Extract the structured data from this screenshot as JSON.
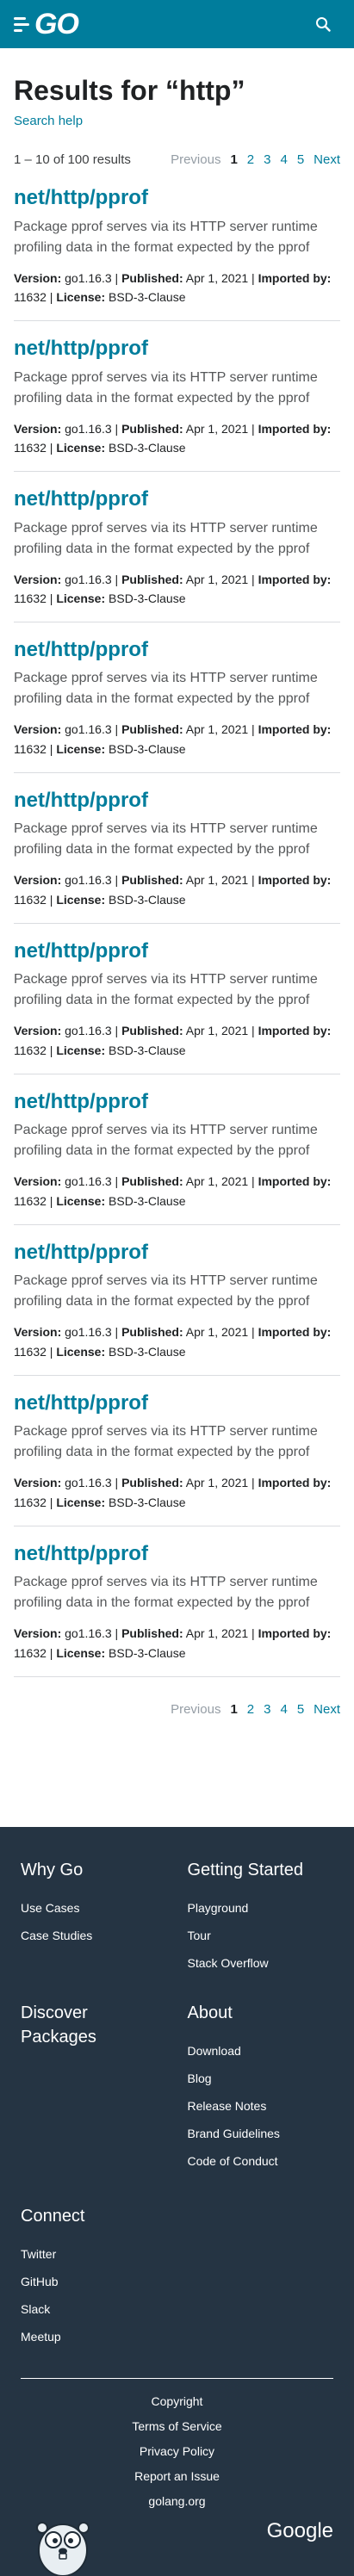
{
  "header": {
    "logo_text": "GO"
  },
  "search": {
    "title": "Results for “http”",
    "help_link": "Search help",
    "results_count": "1 – 10 of 100 results"
  },
  "pager": {
    "previous": "Previous",
    "next": "Next",
    "pages": [
      "1",
      "2",
      "3",
      "4",
      "5"
    ],
    "current": "1"
  },
  "results": [
    {
      "title": "net/http/pprof",
      "synopsis": "Package pprof serves via its HTTP server runtime profiling data in the format expected by the pprof visualization tool.",
      "version_label": "Version:",
      "version": "go1.16.3",
      "published_label": "Published:",
      "published": "Apr 1, 2021",
      "imported_label": "Imported by:",
      "imported": "11632",
      "license_label": "License:",
      "license": "BSD-3-Clause"
    },
    {
      "title": "net/http/pprof",
      "synopsis": "Package pprof serves via its HTTP server runtime profiling data in the format expected by the pprof visualization tool.",
      "version_label": "Version:",
      "version": "go1.16.3",
      "published_label": "Published:",
      "published": "Apr 1, 2021",
      "imported_label": "Imported by:",
      "imported": "11632",
      "license_label": "License:",
      "license": "BSD-3-Clause"
    },
    {
      "title": "net/http/pprof",
      "synopsis": "Package pprof serves via its HTTP server runtime profiling data in the format expected by the pprof visualization tool.",
      "version_label": "Version:",
      "version": "go1.16.3",
      "published_label": "Published:",
      "published": "Apr 1, 2021",
      "imported_label": "Imported by:",
      "imported": "11632",
      "license_label": "License:",
      "license": "BSD-3-Clause"
    },
    {
      "title": "net/http/pprof",
      "synopsis": "Package pprof serves via its HTTP server runtime profiling data in the format expected by the pprof visualization tool.",
      "version_label": "Version:",
      "version": "go1.16.3",
      "published_label": "Published:",
      "published": "Apr 1, 2021",
      "imported_label": "Imported by:",
      "imported": "11632",
      "license_label": "License:",
      "license": "BSD-3-Clause"
    },
    {
      "title": "net/http/pprof",
      "synopsis": "Package pprof serves via its HTTP server runtime profiling data in the format expected by the pprof visualization tool.",
      "version_label": "Version:",
      "version": "go1.16.3",
      "published_label": "Published:",
      "published": "Apr 1, 2021",
      "imported_label": "Imported by:",
      "imported": "11632",
      "license_label": "License:",
      "license": "BSD-3-Clause"
    },
    {
      "title": "net/http/pprof",
      "synopsis": "Package pprof serves via its HTTP server runtime profiling data in the format expected by the pprof visualization tool.",
      "version_label": "Version:",
      "version": "go1.16.3",
      "published_label": "Published:",
      "published": "Apr 1, 2021",
      "imported_label": "Imported by:",
      "imported": "11632",
      "license_label": "License:",
      "license": "BSD-3-Clause"
    },
    {
      "title": "net/http/pprof",
      "synopsis": "Package pprof serves via its HTTP server runtime profiling data in the format expected by the pprof visualization tool.",
      "version_label": "Version:",
      "version": "go1.16.3",
      "published_label": "Published:",
      "published": "Apr 1, 2021",
      "imported_label": "Imported by:",
      "imported": "11632",
      "license_label": "License:",
      "license": "BSD-3-Clause"
    },
    {
      "title": "net/http/pprof",
      "synopsis": "Package pprof serves via its HTTP server runtime profiling data in the format expected by the pprof visualization tool.",
      "version_label": "Version:",
      "version": "go1.16.3",
      "published_label": "Published:",
      "published": "Apr 1, 2021",
      "imported_label": "Imported by:",
      "imported": "11632",
      "license_label": "License:",
      "license": "BSD-3-Clause"
    },
    {
      "title": "net/http/pprof",
      "synopsis": "Package pprof serves via its HTTP server runtime profiling data in the format expected by the pprof visualization tool.",
      "version_label": "Version:",
      "version": "go1.16.3",
      "published_label": "Published:",
      "published": "Apr 1, 2021",
      "imported_label": "Imported by:",
      "imported": "11632",
      "license_label": "License:",
      "license": "BSD-3-Clause"
    },
    {
      "title": "net/http/pprof",
      "synopsis": "Package pprof serves via its HTTP server runtime profiling data in the format expected by the pprof visualization tool.",
      "version_label": "Version:",
      "version": "go1.16.3",
      "published_label": "Published:",
      "published": "Apr 1, 2021",
      "imported_label": "Imported by:",
      "imported": "11632",
      "license_label": "License:",
      "license": "BSD-3-Clause"
    }
  ],
  "footer": {
    "why_go": {
      "title": "Why Go",
      "links": [
        "Use Cases",
        "Case Studies"
      ]
    },
    "getting_started": {
      "title": "Getting Started",
      "links": [
        "Playground",
        "Tour",
        "Stack Overflow"
      ]
    },
    "discover": {
      "title": "Discover Packages",
      "links": []
    },
    "about": {
      "title": "About",
      "links": [
        "Download",
        "Blog",
        "Release Notes",
        "Brand Guidelines",
        "Code of Conduct"
      ]
    },
    "connect": {
      "title": "Connect",
      "links": [
        "Twitter",
        "GitHub",
        "Slack",
        "Meetup"
      ]
    },
    "bottom_links": [
      "Copyright",
      "Terms of Service",
      "Privacy Policy",
      "Report an Issue",
      "golang.org"
    ],
    "google": "Google"
  },
  "colors": {
    "brand": "#007d9c",
    "footer_bg": "#253443",
    "text": "#3e4042"
  },
  "icons": {
    "search": "search-icon",
    "mascot": "gopher-icon"
  }
}
